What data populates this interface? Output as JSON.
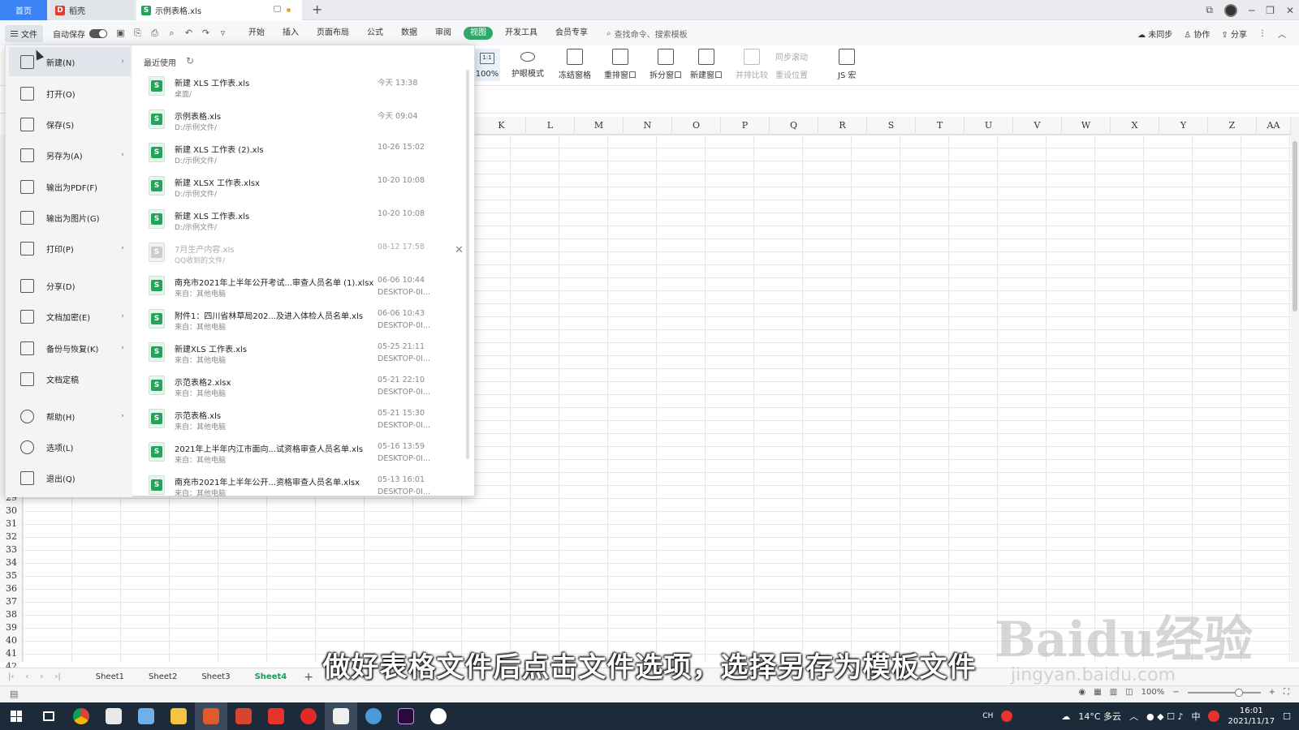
{
  "titlebar": {
    "tabs": [
      {
        "label": "首页"
      },
      {
        "label": "稻壳"
      },
      {
        "label": "示例表格.xls"
      }
    ]
  },
  "menubar": {
    "file_label": "文件",
    "autosave_label": "自动保存",
    "tabs": [
      "开始",
      "插入",
      "页面布局",
      "公式",
      "数据",
      "审阅",
      "视图",
      "开发工具",
      "会员专享"
    ],
    "active_tab": "视图",
    "search_placeholder": "查找命令、搜索模板",
    "right_actions": [
      "未同步",
      "协作",
      "分享"
    ]
  },
  "ribbon": {
    "zoom": "100%",
    "buttons": [
      "护眼模式",
      "冻结窗格",
      "重排窗口",
      "拆分窗口",
      "新建窗口",
      "并排比较",
      "JS 宏"
    ],
    "small_buttons": [
      "同步滚动",
      "重设位置"
    ]
  },
  "grid": {
    "columns": [
      "K",
      "L",
      "M",
      "N",
      "O",
      "P",
      "Q",
      "R",
      "S",
      "T",
      "U",
      "V",
      "W",
      "X",
      "Y",
      "Z",
      "AA"
    ],
    "rows": [
      "29",
      "30",
      "31",
      "32",
      "33",
      "34",
      "35",
      "36",
      "37",
      "38",
      "39",
      "40",
      "41",
      "42"
    ]
  },
  "sheets": {
    "tabs": [
      "Sheet1",
      "Sheet2",
      "Sheet3",
      "Sheet4"
    ],
    "active": "Sheet4"
  },
  "status": {
    "zoom": "100%"
  },
  "file_menu": {
    "items": [
      {
        "label": "新建(N)",
        "arrow": true,
        "selected": true
      },
      {
        "label": "打开(O)",
        "arrow": false
      },
      {
        "label": "保存(S)",
        "arrow": false
      },
      {
        "label": "另存为(A)",
        "arrow": true
      },
      {
        "label": "输出为PDF(F)",
        "arrow": false
      },
      {
        "label": "输出为图片(G)",
        "arrow": false
      },
      {
        "label": "打印(P)",
        "arrow": true
      },
      {
        "label": "分享(D)",
        "arrow": false
      },
      {
        "label": "文档加密(E)",
        "arrow": true
      },
      {
        "label": "备份与恢复(K)",
        "arrow": true
      },
      {
        "label": "文档定稿",
        "arrow": false
      },
      {
        "label": "帮助(H)",
        "arrow": true
      },
      {
        "label": "选项(L)",
        "arrow": false
      },
      {
        "label": "退出(Q)",
        "arrow": false
      }
    ],
    "recent_title": "最近使用",
    "recent": [
      {
        "name": "新建 XLS 工作表.xls",
        "path": "桌面/",
        "time": "今天  13:38",
        "device": ""
      },
      {
        "name": "示例表格.xls",
        "path": "D:/示例文件/",
        "time": "今天  09:04",
        "device": ""
      },
      {
        "name": "新建 XLS 工作表 (2).xls",
        "path": "D:/示例文件/",
        "time": "10-26 15:02",
        "device": ""
      },
      {
        "name": "新建 XLSX 工作表.xlsx",
        "path": "D:/示例文件/",
        "time": "10-20 10:08",
        "device": ""
      },
      {
        "name": "新建 XLS 工作表.xls",
        "path": "D:/示例文件/",
        "time": "10-20 10:08",
        "device": ""
      },
      {
        "name": "7月生产内容.xls",
        "path": "QQ收到的文件/",
        "time": "08-12 17:58",
        "device": "",
        "gray": true
      },
      {
        "name": "南充市2021年上半年公开考试...审查人员名单 (1).xlsx",
        "path": "来自：其他电脑",
        "time": "06-06 10:44",
        "device": "DESKTOP-0I..."
      },
      {
        "name": "附件1：四川省林草局202...及进入体检人员名单.xls",
        "path": "来自：其他电脑",
        "time": "06-06 10:43",
        "device": "DESKTOP-0I..."
      },
      {
        "name": "新建XLS 工作表.xls",
        "path": "来自：其他电脑",
        "time": "05-25 21:11",
        "device": "DESKTOP-0I..."
      },
      {
        "name": "示范表格2.xlsx",
        "path": "来自：其他电脑",
        "time": "05-21 22:10",
        "device": "DESKTOP-0I..."
      },
      {
        "name": "示范表格.xls",
        "path": "来自：其他电脑",
        "time": "05-21 15:30",
        "device": "DESKTOP-0I..."
      },
      {
        "name": "2021年上半年内江市面向...试资格审查人员名单.xls",
        "path": "来自：其他电脑",
        "time": "05-16 13:59",
        "device": "DESKTOP-0I..."
      },
      {
        "name": "南充市2021年上半年公开...资格审查人员名单.xlsx",
        "path": "来自：其他电脑",
        "time": "05-13 16:01",
        "device": "DESKTOP-0I..."
      }
    ]
  },
  "caption": "做好表格文件后点击文件选项，选择另存为模板文件",
  "watermark": {
    "brand": "Baidu经验",
    "url": "jingyan.baidu.com"
  },
  "taskbar": {
    "ime": "CH",
    "weather": "14°C  多云",
    "lang": "中",
    "time": "16:01",
    "date": "2021/11/17"
  },
  "colors": {
    "accent": "#2fa86a",
    "tab_active": "#3c83f6"
  }
}
